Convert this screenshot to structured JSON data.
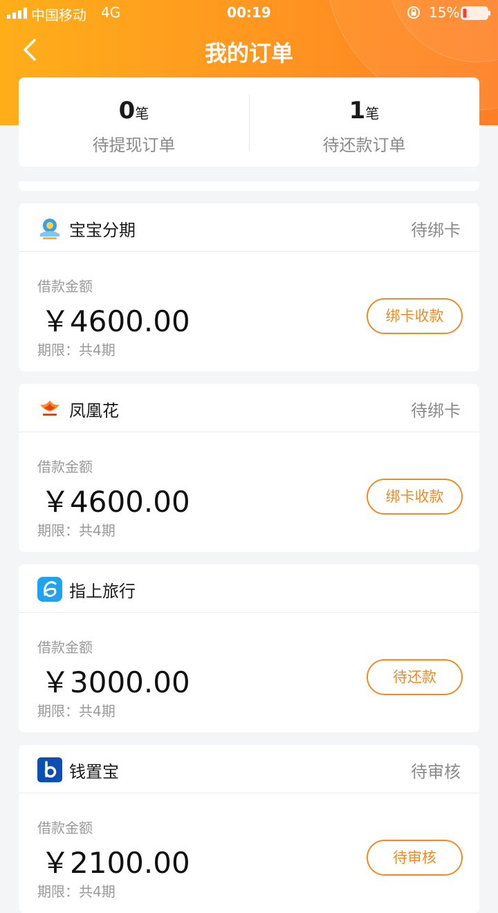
{
  "status_bar": {
    "carrier": "中国移动",
    "network": "4G",
    "time": "00:19",
    "battery": "15%"
  },
  "nav": {
    "title": "我的订单"
  },
  "summary": {
    "withdraw": {
      "count": "0",
      "unit": "笔",
      "label": "待提现订单"
    },
    "repay": {
      "count": "1",
      "unit": "笔",
      "label": "待还款订单"
    }
  },
  "orders": [
    {
      "name": "宝宝分期",
      "status": "待绑卡",
      "amount_label": "借款金额",
      "amount": "￥4600.00",
      "term": "期限：共4期",
      "action": "绑卡收款",
      "logo": "baby-logo-icon"
    },
    {
      "name": "凤凰花",
      "status": "待绑卡",
      "amount_label": "借款金额",
      "amount": "￥4600.00",
      "term": "期限：共4期",
      "action": "绑卡收款",
      "logo": "phoenix-logo-icon"
    },
    {
      "name": "指上旅行",
      "status": "",
      "amount_label": "借款金额",
      "amount": "￥3000.00",
      "term": "期限：共4期",
      "action": "待还款",
      "logo": "travel-logo-icon"
    },
    {
      "name": "钱置宝",
      "status": "待审核",
      "amount_label": "借款金额",
      "amount": "￥2100.00",
      "term": "期限：共4期",
      "action": "待审核",
      "logo": "money-logo-icon"
    }
  ],
  "colors": {
    "accent": "#f08a24",
    "header_start": "#ffae1a",
    "header_end": "#ff7f24",
    "battery_low": "#ff3b30"
  }
}
